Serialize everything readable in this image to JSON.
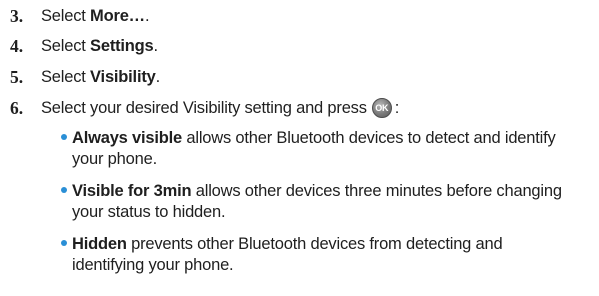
{
  "steps": [
    {
      "num": "3.",
      "pre": "Select ",
      "bold": "More…",
      "post": "."
    },
    {
      "num": "4.",
      "pre": "Select ",
      "bold": "Settings",
      "post": "."
    },
    {
      "num": "5.",
      "pre": "Select ",
      "bold": "Visibility",
      "post": "."
    },
    {
      "num": "6.",
      "text": "Select your desired Visibility setting and press",
      "button_label": "OK",
      "suffix": ":"
    }
  ],
  "bullets": [
    {
      "term": "Always visible",
      "line1": " allows other Bluetooth devices to detect and identify",
      "line2": "your phone."
    },
    {
      "term": "Visible for 3min",
      "line1": " allows other devices three minutes before changing",
      "line2": "your status to hidden."
    },
    {
      "term": "Hidden",
      "line1": " prevents other Bluetooth devices from detecting and",
      "line2": "identifying your phone."
    }
  ],
  "colors": {
    "bullet": "#2a8fd6",
    "text": "#1f1f1f"
  }
}
